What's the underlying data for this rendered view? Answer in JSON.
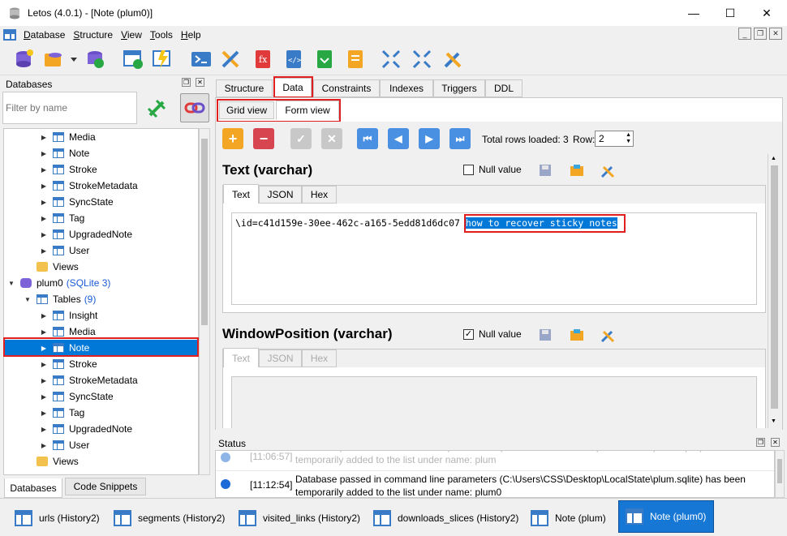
{
  "window": {
    "title": "Letos (4.0.1) - [Note (plum0)]",
    "minimize": "—",
    "maximize": "☐",
    "close": "✕"
  },
  "menu": [
    "Database",
    "Structure",
    "View",
    "Tools",
    "Help"
  ],
  "left": {
    "panel_title": "Databases",
    "filter_placeholder": "Filter by name",
    "tree_top": [
      "Media",
      "Note",
      "Stroke",
      "StrokeMetadata",
      "SyncState",
      "Tag",
      "UpgradedNote",
      "User"
    ],
    "views1": "Views",
    "db": "plum0",
    "db_type": "(SQLite 3)",
    "tables_label": "Tables",
    "tables_count": "(9)",
    "tables": [
      "Insight",
      "Media",
      "Note",
      "Stroke",
      "StrokeMetadata",
      "SyncState",
      "Tag",
      "UpgradedNote",
      "User"
    ],
    "views2": "Views",
    "bottom_tabs": [
      "Databases",
      "Code Snippets"
    ]
  },
  "tabs": [
    "Structure",
    "Data",
    "Constraints",
    "Indexes",
    "Triggers",
    "DDL"
  ],
  "subtabs": [
    "Grid view",
    "Form view"
  ],
  "nav": {
    "total_rows": "Total rows loaded: 3",
    "row_label": "Row:",
    "row_value": "2"
  },
  "field1": {
    "name": "Text (varchar)",
    "null_label": "Null value",
    "null_checked": false,
    "tabs": [
      "Text",
      "JSON",
      "Hex"
    ],
    "value_prefix": "\\id=c41d159e-30ee-462c-a165-5edd81d6dc07 ",
    "value_selected": "how to recover sticky notes"
  },
  "field2": {
    "name": "WindowPosition (varchar)",
    "null_label": "Null value",
    "null_checked": true,
    "tabs": [
      "Text",
      "JSON",
      "Hex"
    ]
  },
  "status": {
    "title": "Status",
    "rows": [
      {
        "time": "[11:06:57]",
        "msg": "Database passed in command line parameters (C:\\Users\\CSS\\Desktop\\LocalState\\plum.sqlite) has been temporarily added to the list under name: plum"
      },
      {
        "time": "[11:12:54]",
        "msg": "Database passed in command line parameters (C:\\Users\\CSS\\Desktop\\LocalState\\plum.sqlite) has been temporarily added to the list under name: plum0"
      }
    ]
  },
  "taskbar": [
    "urls (History2)",
    "segments (History2)",
    "visited_links (History2)",
    "downloads_slices (History2)",
    "Note (plum)",
    "Note (plum0)"
  ],
  "colors": {
    "accent": "#1677d4",
    "highlight_red": "#e02020",
    "selection": "#0078d7"
  }
}
